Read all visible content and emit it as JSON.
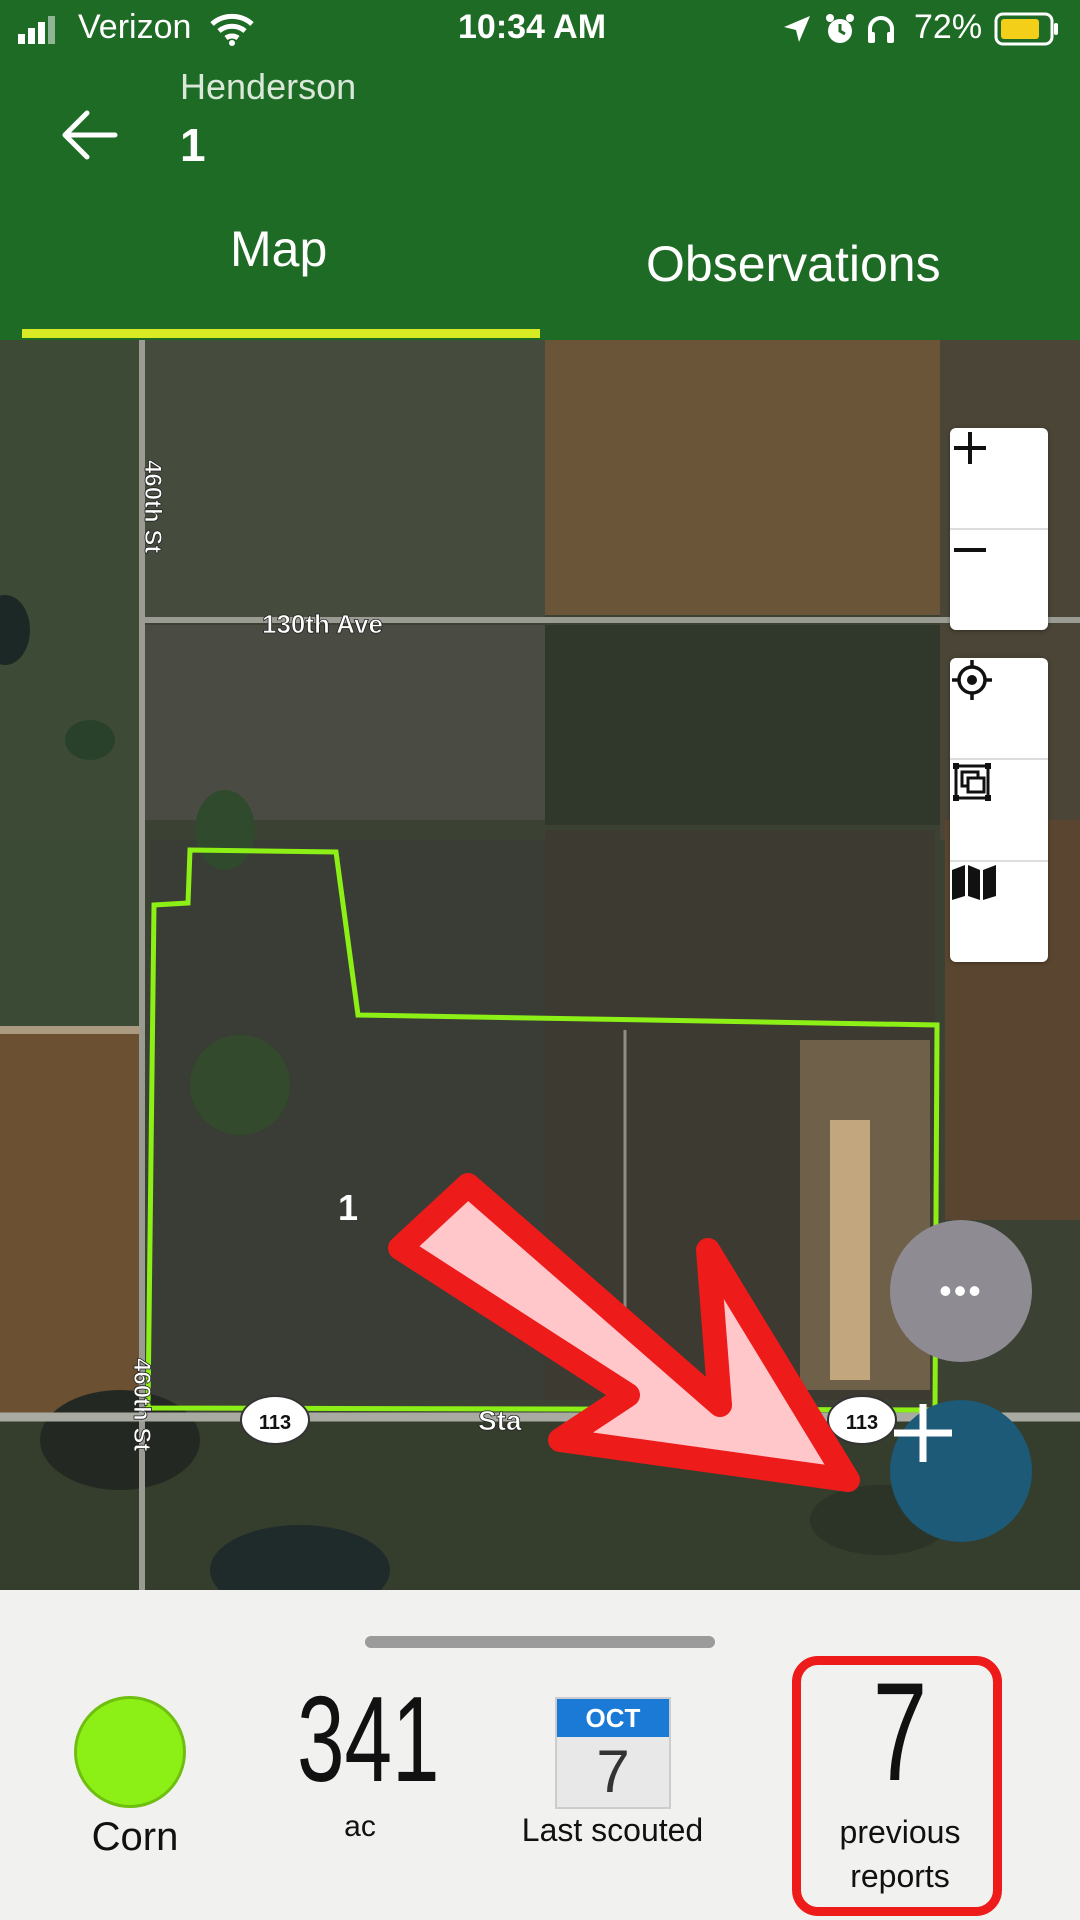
{
  "status_bar": {
    "carrier": "Verizon",
    "time": "10:34 AM",
    "battery": "72%"
  },
  "header": {
    "subtitle": "Henderson",
    "title": "1",
    "tabs": [
      {
        "label": "Map",
        "active": true
      },
      {
        "label": "Observations",
        "active": false
      }
    ],
    "colors": {
      "header_bg": "#1e6b25",
      "tab_indicator": "#d7ea24"
    }
  },
  "map": {
    "road_labels": [
      "460th St",
      "130th Ave",
      "460th St",
      "Sta"
    ],
    "highway_shields": [
      "113",
      "113"
    ],
    "field_label": "1",
    "controls": {
      "zoom_in_icon": "plus-icon",
      "zoom_out_icon": "minus-icon",
      "locate_icon": "crosshair-icon",
      "fit_icon": "fit-bounds-icon",
      "layers_icon": "map-layers-icon"
    },
    "boundary_color": "#8cf016"
  },
  "fabs": {
    "more_label": "•••",
    "add_label": "+",
    "colors": {
      "more": "#8e8b93",
      "add": "#1c5a78"
    }
  },
  "field_summary": {
    "crop": "Corn",
    "crop_color": "#8cf016",
    "acres": "341",
    "acres_unit": "ac",
    "last_scouted_month": "OCT",
    "last_scouted_day": "7",
    "last_scouted_label": "Last scouted",
    "previous_reports_count": "7",
    "previous_reports_label_1": "previous",
    "previous_reports_label_2": "reports"
  },
  "annotation": {
    "arrow_color": "#ee1b1b",
    "arrow_fill": "#ffc7c9"
  }
}
